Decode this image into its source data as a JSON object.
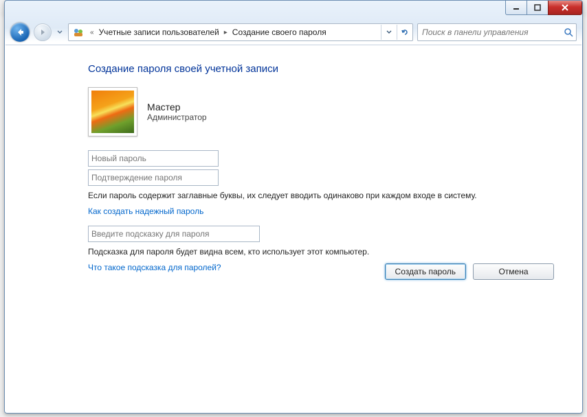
{
  "caption": {
    "minimize": "–",
    "maximize": "❐",
    "close": "X"
  },
  "breadcrumb": {
    "prefix": "«",
    "level1": "Учетные записи пользователей",
    "level2": "Создание своего пароля"
  },
  "search": {
    "placeholder": "Поиск в панели управления"
  },
  "page": {
    "title": "Создание пароля своей учетной записи"
  },
  "user": {
    "name": "Мастер",
    "role": "Администратор"
  },
  "inputs": {
    "new_pw_placeholder": "Новый пароль",
    "confirm_pw_placeholder": "Подтверждение пароля",
    "hint_placeholder": "Введите подсказку для пароля"
  },
  "text": {
    "caps_note": "Если пароль содержит заглавные буквы, их следует вводить одинаково при каждом входе в систему.",
    "hint_visible_note": "Подсказка для пароля будет видна всем, кто использует этот компьютер."
  },
  "links": {
    "strong_pw": "Как создать надежный пароль",
    "what_is_hint": "Что такое подсказка для паролей?"
  },
  "buttons": {
    "create": "Создать пароль",
    "cancel": "Отмена"
  }
}
